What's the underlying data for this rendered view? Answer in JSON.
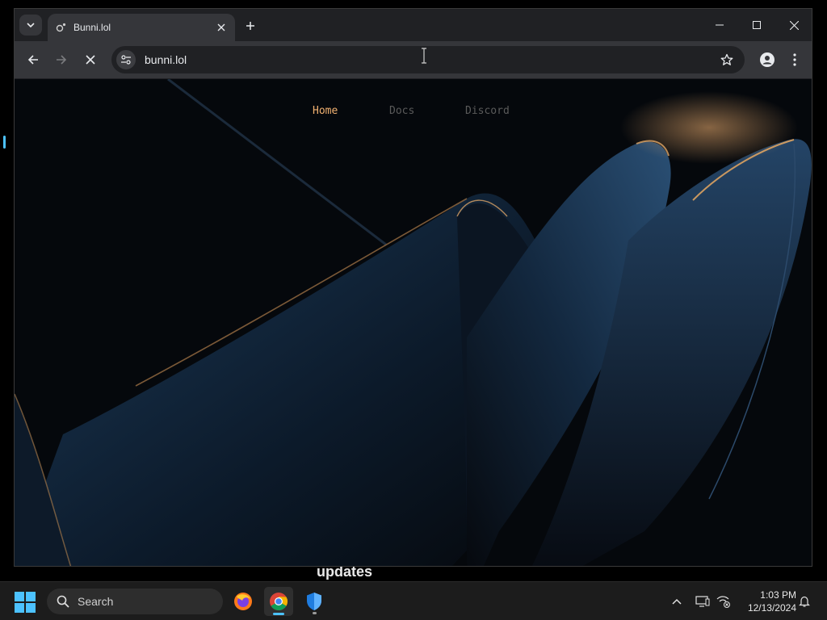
{
  "browser": {
    "tab_title": "Bunni.lol",
    "url": "bunni.lol"
  },
  "site": {
    "nav": [
      {
        "label": "Home",
        "color": "#f0b070"
      },
      {
        "label": "Docs",
        "color": "#5a5a5a"
      },
      {
        "label": "Discord",
        "color": "#5a5a5a"
      }
    ]
  },
  "desktop": {
    "updates_text": "updates"
  },
  "taskbar": {
    "search_label": "Search",
    "time": "1:03 PM",
    "date": "12/13/2024",
    "apps": [
      "firefox-icon",
      "chrome-icon",
      "defender-icon"
    ]
  },
  "colors": {
    "accent": "#4cc2ff",
    "hero_highlight": "#f0b070"
  }
}
